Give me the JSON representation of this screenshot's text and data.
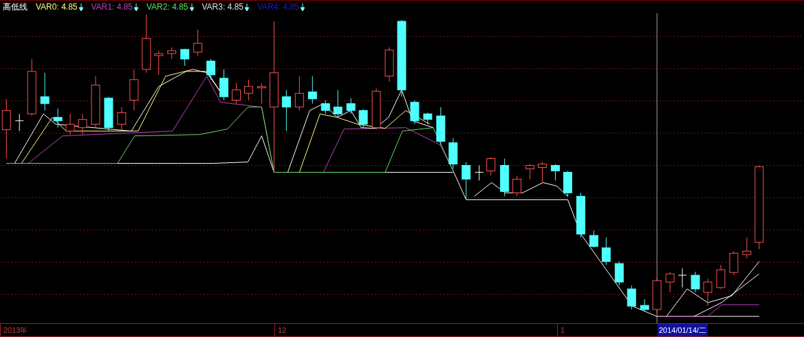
{
  "title": "高低线",
  "indicators": [
    {
      "name": "VAR0:",
      "value": "4.85",
      "color": "#ffff80"
    },
    {
      "name": "VAR1:",
      "value": "4.85",
      "color": "#c040c0"
    },
    {
      "name": "VAR2:",
      "value": "4.85",
      "color": "#60e060"
    },
    {
      "name": "VAR3:",
      "value": "4.85",
      "color": "#e0e0e0"
    },
    {
      "name": "VAR4:",
      "value": "4.85",
      "color": "#2020b0"
    }
  ],
  "time_axis": {
    "labels": [
      "2013年",
      "12",
      "1"
    ],
    "cursor_date": "2014/01/14/二"
  }
}
